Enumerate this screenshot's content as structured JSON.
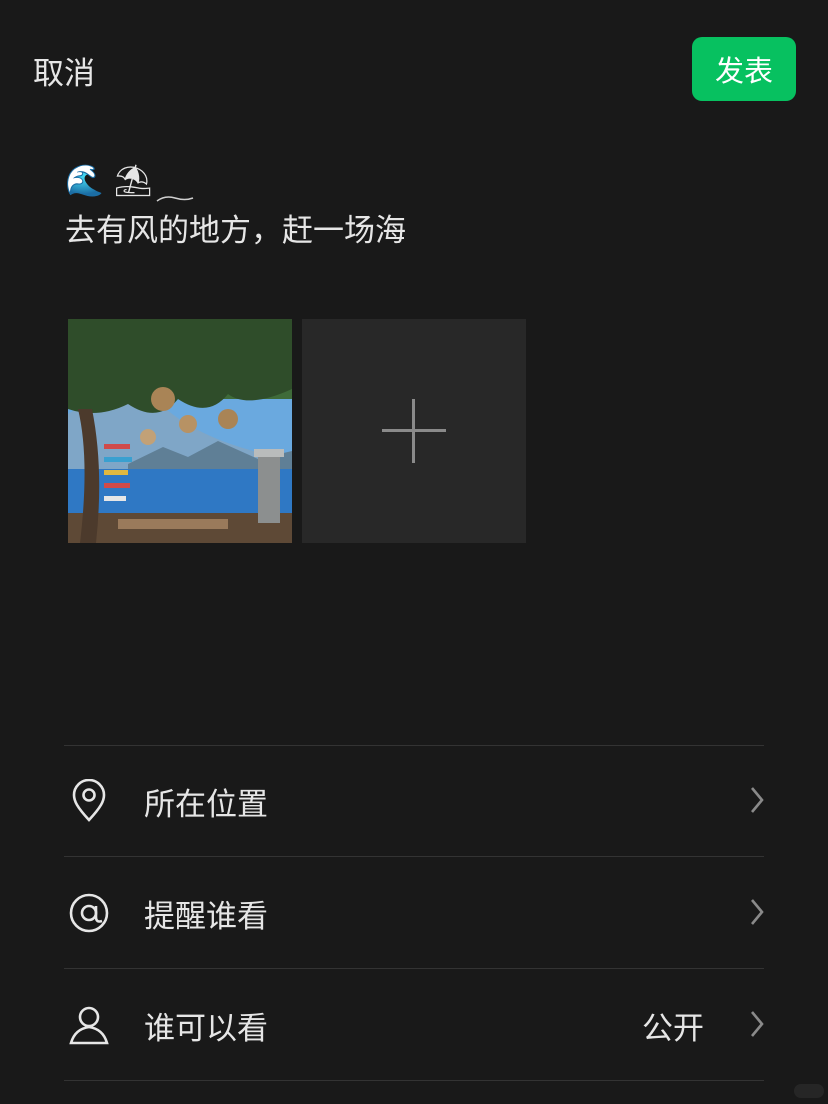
{
  "header": {
    "cancel_label": "取消",
    "publish_label": "发表"
  },
  "post": {
    "emoji_prefix": "🌊 ⛱",
    "text": "去有风的地方，赶一场海"
  },
  "media": {
    "photo_count": 1,
    "add_icon": "plus-icon"
  },
  "options": {
    "location": {
      "icon": "location-pin-icon",
      "label": "所在位置"
    },
    "mention": {
      "icon": "at-icon",
      "label": "提醒谁看"
    },
    "visibility": {
      "icon": "person-icon",
      "label": "谁可以看",
      "value": "公开"
    }
  },
  "colors": {
    "background": "#191919",
    "accent_green": "#07c160",
    "text": "#e6e6e6"
  }
}
